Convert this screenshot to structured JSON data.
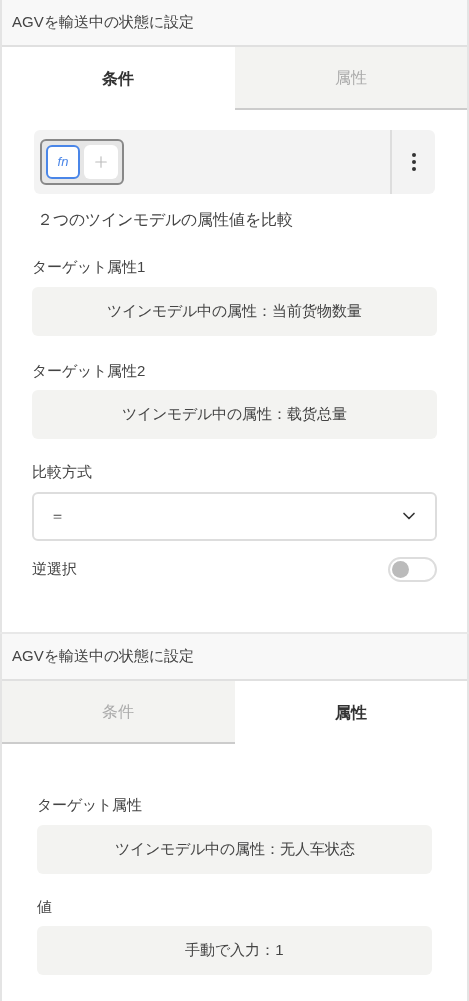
{
  "panels": [
    {
      "title": "AGVを輸送中の状態に設定",
      "tabs": [
        {
          "label": "条件",
          "selected": true
        },
        {
          "label": "属性",
          "selected": false
        }
      ],
      "items": [
        {
          "kind": "toolbar",
          "chips": [
            {
              "kind": "function",
              "label": "fn",
              "selected": true
            },
            {
              "kind": "add",
              "selected": false
            }
          ]
        },
        {
          "kind": "text",
          "text": "２つのツインモデルの属性値を比較"
        },
        {
          "kind": "field",
          "label": "ターゲット属性1",
          "value": "ツインモデル中の属性：当前货物数量"
        },
        {
          "kind": "field",
          "label": "ターゲット属性2",
          "value": "ツインモデル中の属性：载货总量"
        },
        {
          "kind": "select",
          "label": "比較方式",
          "value": "＝"
        },
        {
          "kind": "toggle",
          "label": "逆選択",
          "on": false
        }
      ]
    },
    {
      "title": "AGVを輸送中の状態に設定",
      "tabs": [
        {
          "label": "条件",
          "selected": false
        },
        {
          "label": "属性",
          "selected": true
        }
      ],
      "items": [
        {
          "kind": "field",
          "label": "ターゲット属性",
          "value": "ツインモデル中の属性：无人车状态"
        },
        {
          "kind": "field",
          "label": "値",
          "value": "手動で入力：1"
        }
      ]
    }
  ]
}
